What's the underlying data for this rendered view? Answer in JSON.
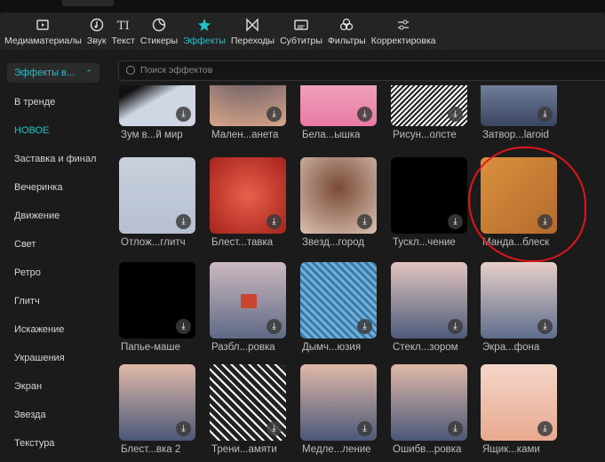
{
  "toolbar": {
    "items": [
      {
        "label": "Медиаматериалы",
        "icon": "media-icon"
      },
      {
        "label": "Звук",
        "icon": "music-icon"
      },
      {
        "label": "Текст",
        "icon": "text-icon"
      },
      {
        "label": "Стикеры",
        "icon": "sticker-icon"
      },
      {
        "label": "Эффекты",
        "icon": "effects-star-icon",
        "active": true
      },
      {
        "label": "Переходы",
        "icon": "transition-icon"
      },
      {
        "label": "Субтитры",
        "icon": "subtitles-icon"
      },
      {
        "label": "Фильтры",
        "icon": "filters-icon"
      },
      {
        "label": "Корректировка",
        "icon": "adjust-icon"
      }
    ]
  },
  "sidebar": {
    "dropdown": "Эффекты в...",
    "items": [
      "В тренде",
      "НОВОЕ",
      "Заставка и финал",
      "Вечеринка",
      "Движение",
      "Свет",
      "Ретро",
      "Глитч",
      "Искажение",
      "Украшения",
      "Экран",
      "Звезда",
      "Текстура"
    ],
    "active": "НОВОЕ"
  },
  "search": {
    "placeholder": "Поиск эффектов"
  },
  "effects": [
    "Зум в...й мир",
    "Мален...анета",
    "Бела...ышка",
    "Рисун...олсте",
    "Затвор...laroid",
    "Отлож...глитч",
    "Блест...тавка",
    "Звезд...город",
    "Тускл...чение",
    "Манда...блеск",
    "Папье-маше",
    "Разбл...ровка",
    "Дымч...юзия",
    "Стекл...зором",
    "Экра...фона",
    "Блест...вка 2",
    "Трени...амяти",
    "Медле...ление",
    "Ошибв...ровка",
    "Ящик...ками"
  ],
  "colors": {
    "accent": "#1fc3c9",
    "highlight": "#e0161b"
  }
}
